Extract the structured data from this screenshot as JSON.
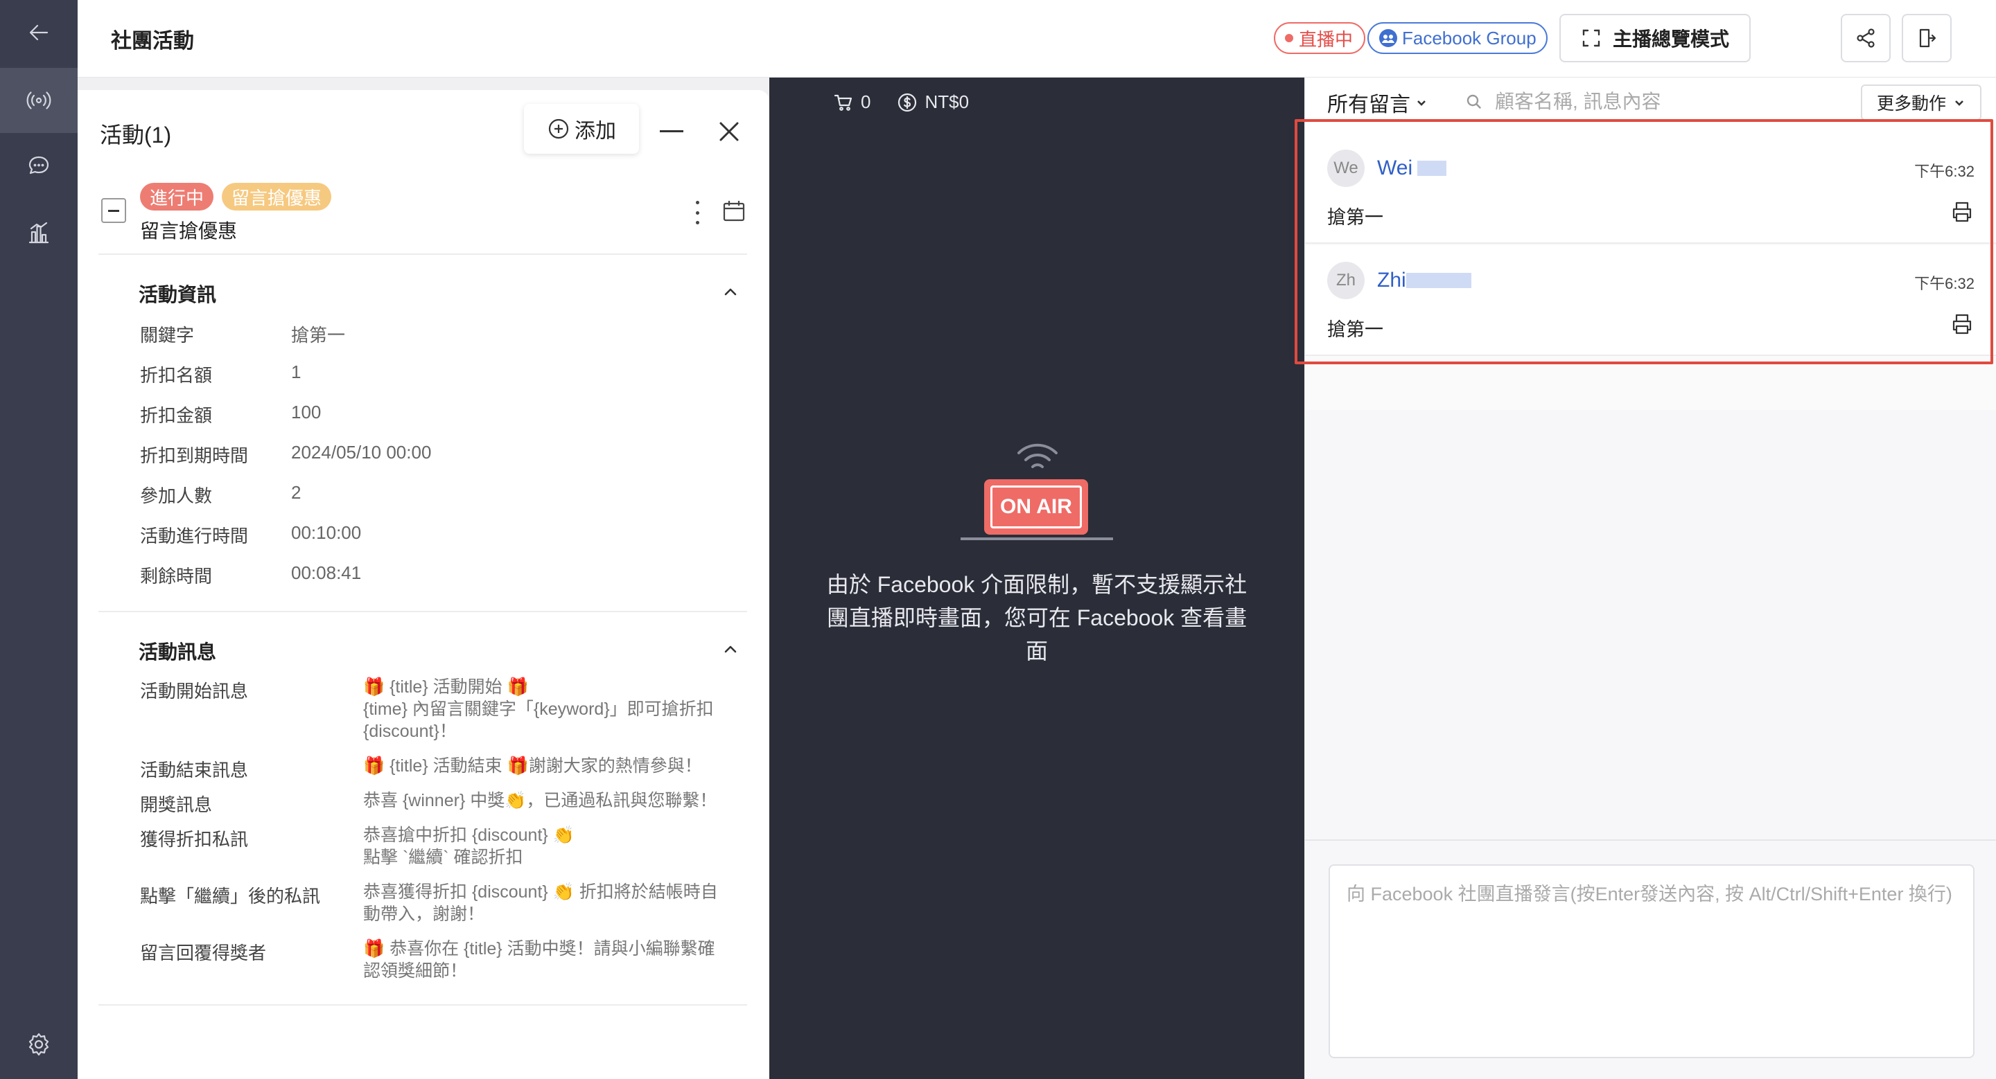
{
  "header": {
    "title": "社團活動",
    "live_badge": "直播中",
    "group_badge": "Facebook Group",
    "mode_button": "主播總覽模式"
  },
  "rail": {
    "icons": [
      "back-arrow-icon",
      "broadcast-icon",
      "chat-icon",
      "analytics-icon",
      "settings-icon"
    ]
  },
  "activity_panel": {
    "title": "活動(1)",
    "add_label": "添加",
    "activity": {
      "status_tag": "進行中",
      "type_tag": "留言搶優惠",
      "name": "留言搶優惠"
    },
    "info_section": {
      "title": "活動資訊",
      "rows": [
        {
          "label": "關鍵字",
          "value": "搶第一"
        },
        {
          "label": "折扣名額",
          "value": "1"
        },
        {
          "label": "折扣金額",
          "value": "100"
        },
        {
          "label": "折扣到期時間",
          "value": "2024/05/10 00:00"
        },
        {
          "label": "參加人數",
          "value": "2"
        },
        {
          "label": "活動進行時間",
          "value": "00:10:00"
        },
        {
          "label": "剩餘時間",
          "value": "00:08:41"
        }
      ]
    },
    "message_section": {
      "title": "活動訊息",
      "rows": [
        {
          "label": "活動開始訊息",
          "value": "🎁 {title} 活動開始 🎁\n{time} 內留言關鍵字「{keyword}」即可搶折扣\n{discount}！"
        },
        {
          "label": "活動結束訊息",
          "value": "🎁 {title} 活動結束 🎁謝謝大家的熱情參與！"
        },
        {
          "label": "開獎訊息",
          "value": "恭喜 {winner} 中獎👏，已通過私訊與您聯繫！"
        },
        {
          "label": "獲得折扣私訊",
          "value": "恭喜搶中折扣 {discount} 👏\n點擊 `繼續` 確認折扣"
        },
        {
          "label": "點擊「繼續」後的私訊",
          "value": "恭喜獲得折扣 {discount} 👏 折扣將於結帳時自\n動帶入，謝謝！"
        },
        {
          "label": "留言回覆得獎者",
          "value": "🎁 恭喜你在 {title} 活動中獎！請與小編聯繫確\n認領獎細節！"
        }
      ]
    }
  },
  "live": {
    "cart_count": "0",
    "cart_amount": "NT$0",
    "on_air_label": "ON AIR",
    "notice": "由於 Facebook 介面限制，暫不支援顯示社團直播即時畫面，您可在 Facebook 查看畫面"
  },
  "comments": {
    "filter_label": "所有留言",
    "search_placeholder": "顧客名稱, 訊息內容",
    "more_actions": "更多動作",
    "items": [
      {
        "initials": "We",
        "name": "Wei",
        "time": "下午6:32",
        "text": "搶第一"
      },
      {
        "initials": "Zh",
        "name": "Zhi",
        "time": "下午6:32",
        "text": "搶第一"
      }
    ],
    "input_placeholder": "向 Facebook 社團直播發言(按Enter發送內容, 按 Alt/Ctrl/Shift+Enter 換行)"
  },
  "colors": {
    "rail_bg": "#3a3d4d",
    "live_bg": "#2b2d38",
    "live_red": "#ef6b66",
    "fb_blue": "#3f6fd1",
    "highlight_red": "#e04b3f"
  }
}
